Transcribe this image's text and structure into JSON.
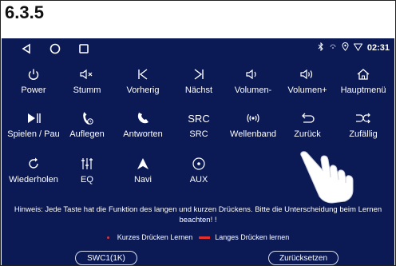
{
  "section_label": "6.3.5",
  "status": {
    "time": "02:31"
  },
  "rows": [
    [
      {
        "label": "Power",
        "icon": "power-icon"
      },
      {
        "label": "Stumm",
        "icon": "mute-icon"
      },
      {
        "label": "Vorherig",
        "icon": "previous-icon"
      },
      {
        "label": "Nächst",
        "icon": "next-icon"
      },
      {
        "label": "Volumen-",
        "icon": "volume-down-icon"
      },
      {
        "label": "Volumen+",
        "icon": "volume-up-icon"
      },
      {
        "label": "Hauptmenü",
        "icon": "home-icon"
      }
    ],
    [
      {
        "label": "Spielen / Pau",
        "icon": "play-pause-icon"
      },
      {
        "label": "Auflegen",
        "icon": "hang-up-icon"
      },
      {
        "label": "Antworten",
        "icon": "answer-icon"
      },
      {
        "label": "SRC",
        "icon": "src-icon",
        "symbol_text": "SRC"
      },
      {
        "label": "Wellenband",
        "icon": "radio-wave-icon"
      },
      {
        "label": "Zurück",
        "icon": "back-icon"
      },
      {
        "label": "Zufällig",
        "icon": "shuffle-icon"
      }
    ],
    [
      {
        "label": "Wiederholen",
        "icon": "repeat-icon"
      },
      {
        "label": "EQ",
        "icon": "equalizer-icon"
      },
      {
        "label": "Navi",
        "icon": "navigation-icon"
      },
      {
        "label": "AUX",
        "icon": "aux-icon"
      }
    ]
  ],
  "hint_text": "Hinweis: Jede Taste hat die Funktion des langen und kurzen Drückens. Bitte die Unterscheidung beim Lernen beachten! !",
  "legend": {
    "short_press": "Kurzes Drücken Lernen",
    "long_press": "Langes Drücken lernen",
    "accent_color": "#e53030"
  },
  "buttons": {
    "swc": "SWC1(1K)",
    "reset": "Zurücksetzen"
  },
  "colors": {
    "screen_bg": "#0b1a55"
  }
}
